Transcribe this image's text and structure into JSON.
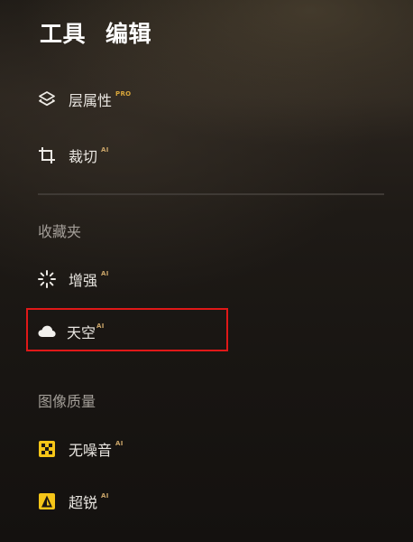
{
  "header": {
    "tab_tools": "工具",
    "tab_edit": "编辑"
  },
  "tools": [
    {
      "label": "层属性",
      "badge": "PRO",
      "icon": "layers-icon"
    },
    {
      "label": "裁切",
      "badge": "AI",
      "icon": "crop-icon"
    }
  ],
  "favorites": {
    "title": "收藏夹",
    "items": [
      {
        "label": "增强",
        "badge": "AI",
        "icon": "sparkle-icon"
      },
      {
        "label": "天空",
        "badge": "AI",
        "icon": "cloud-icon"
      }
    ]
  },
  "image_quality": {
    "title": "图像质量",
    "items": [
      {
        "label": "无噪音",
        "badge": "AI",
        "icon": "denoise-icon"
      },
      {
        "label": "超锐",
        "badge": "AI",
        "icon": "sharpen-icon"
      }
    ]
  },
  "colors": {
    "pro_badge": "#d8a63a",
    "ai_badge": "#c9a468",
    "icon_yellow": "#f5c518",
    "highlight": "#e01818"
  }
}
